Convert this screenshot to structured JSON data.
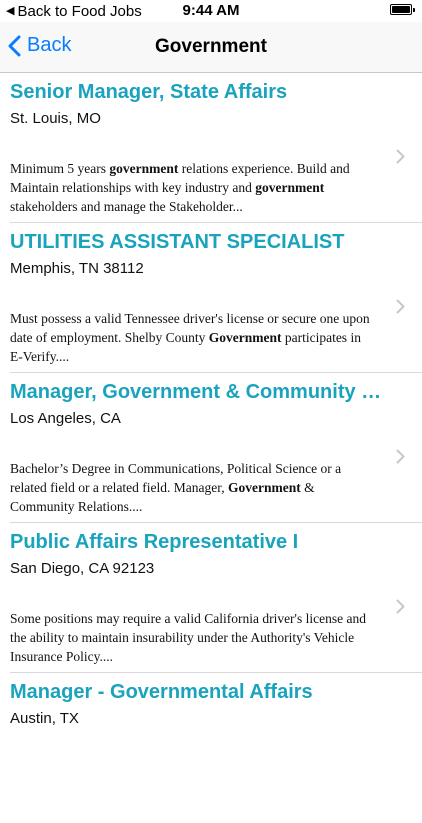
{
  "status_bar": {
    "back_label": "Back to Food Jobs",
    "time": "9:44 AM"
  },
  "nav": {
    "back_label": "Back",
    "title": "Government"
  },
  "colors": {
    "accent_blue": "#0a7cff",
    "job_title_teal": "#1aa3bd"
  },
  "jobs": [
    {
      "title": "Senior Manager, State Affairs",
      "location": "St. Louis, MO",
      "description": [
        {
          "t": "Minimum 5 years ",
          "b": false
        },
        {
          "t": "government",
          "b": true
        },
        {
          "t": " relations experience. Build and Maintain relationships with key industry and ",
          "b": false
        },
        {
          "t": "government",
          "b": true
        },
        {
          "t": " stakeholders and manage the Stakeholder...",
          "b": false
        }
      ]
    },
    {
      "title": "UTILITIES ASSISTANT SPECIALIST",
      "location": "Memphis, TN 38112",
      "description": [
        {
          "t": "Must possess a valid Tennessee driver's license or secure one upon date of employment. Shelby County ",
          "b": false
        },
        {
          "t": "Government",
          "b": true
        },
        {
          "t": " participates in E-Verify....",
          "b": false
        }
      ]
    },
    {
      "title": "Manager, Government & Community R...",
      "location": "Los Angeles, CA",
      "description": [
        {
          "t": "Bachelor’s Degree in Communications, Political Science or a related field or a related field. Manager, ",
          "b": false
        },
        {
          "t": "Government",
          "b": true
        },
        {
          "t": " & Community Relations....",
          "b": false
        }
      ]
    },
    {
      "title": "Public Affairs Representative I",
      "location": "San Diego, CA 92123",
      "description": [
        {
          "t": "Some positions may require a valid California driver's license and the ability to maintain insurability under the Authority's Vehicle Insurance Policy....",
          "b": false
        }
      ]
    },
    {
      "title": "Manager - Governmental Affairs",
      "location": "Austin, TX",
      "description": []
    }
  ]
}
